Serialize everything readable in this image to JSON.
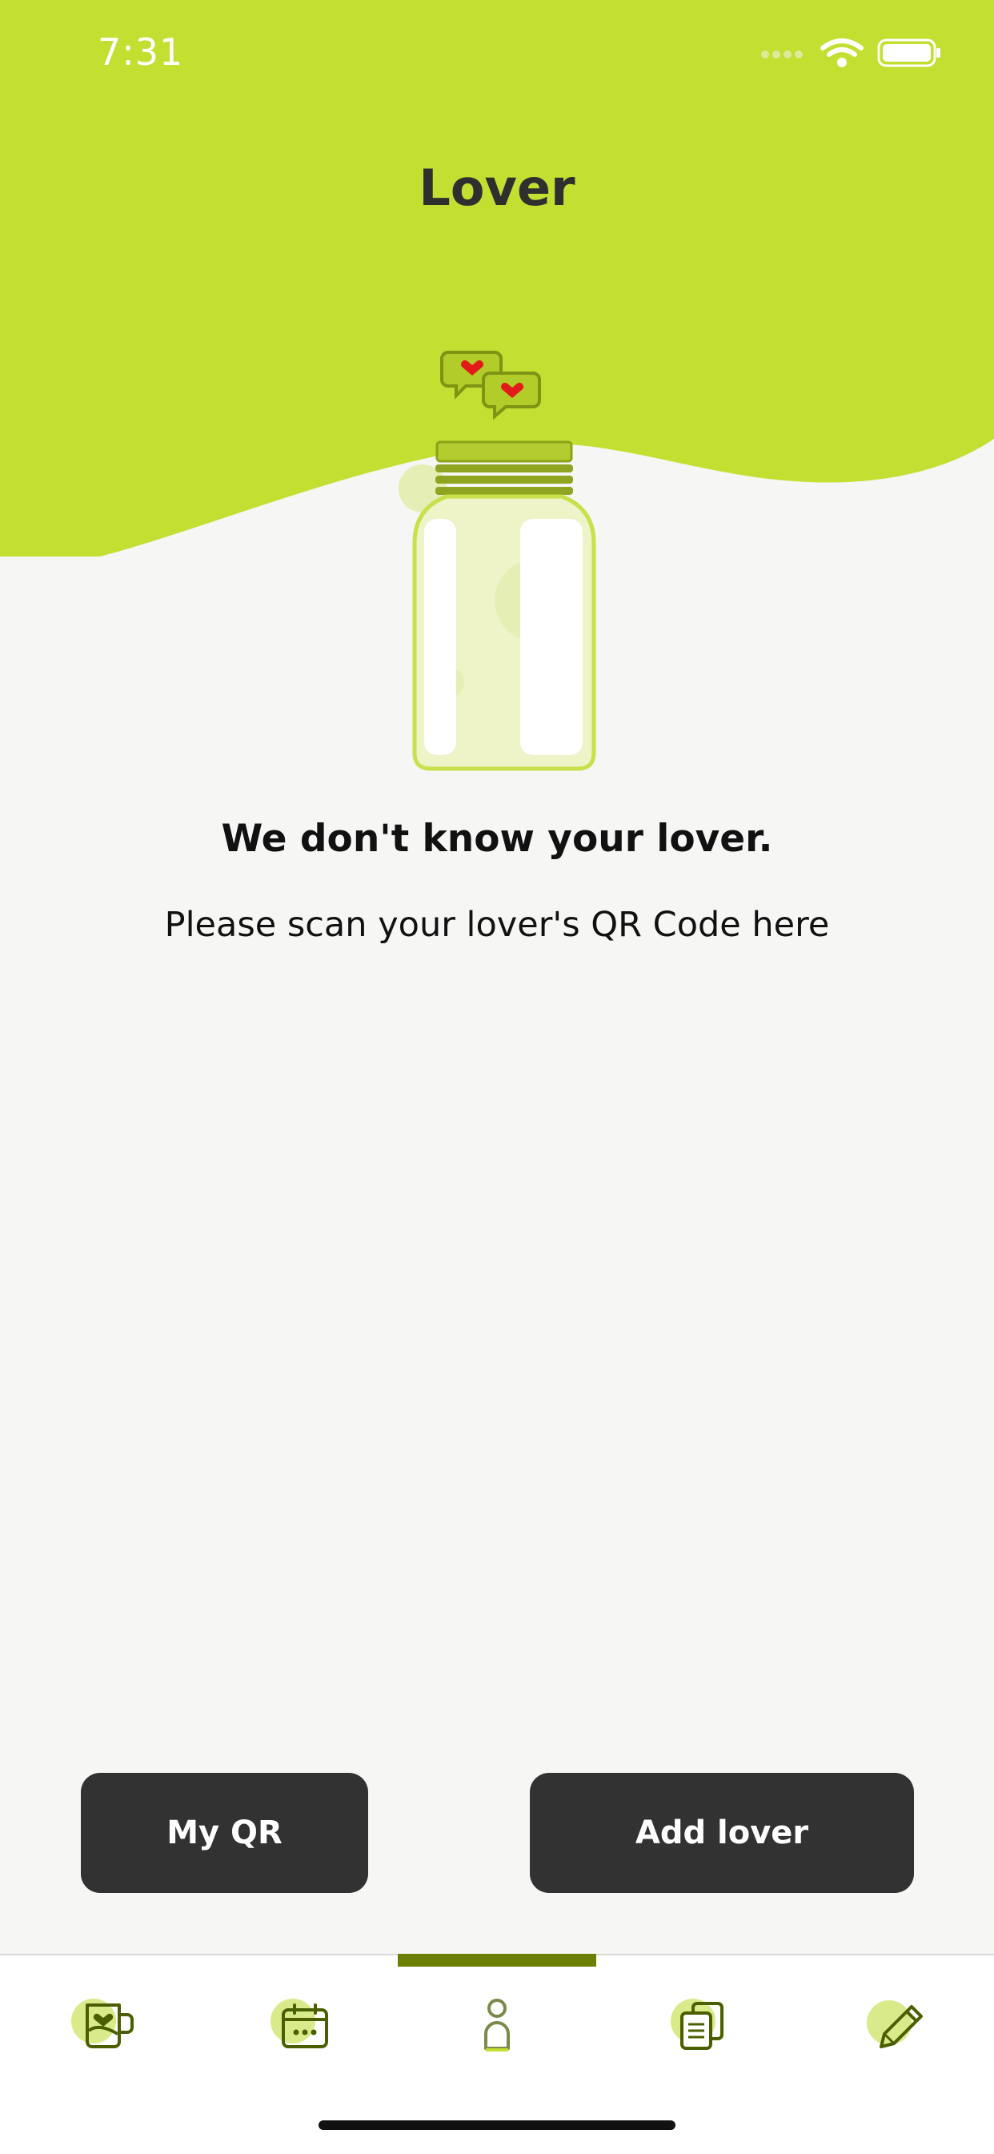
{
  "status_bar": {
    "time": "7:31"
  },
  "header": {
    "title": "Lover"
  },
  "empty_state": {
    "title": "We don't know your lover.",
    "subtitle": "Please scan your lover's QR Code here"
  },
  "actions": {
    "my_qr_label": "My QR",
    "add_lover_label": "Add lover"
  },
  "tab_bar": {
    "tabs": [
      {
        "icon": "jar-heart-icon",
        "selected": false
      },
      {
        "icon": "calendar-icon",
        "selected": false
      },
      {
        "icon": "person-icon",
        "selected": true
      },
      {
        "icon": "documents-icon",
        "selected": false
      },
      {
        "icon": "pencil-icon",
        "selected": false
      }
    ]
  },
  "colors": {
    "header_green": "#c2df32",
    "background": "#f6f6f4",
    "button_dark": "#323232",
    "tab_indicator": "#6b7f00"
  }
}
